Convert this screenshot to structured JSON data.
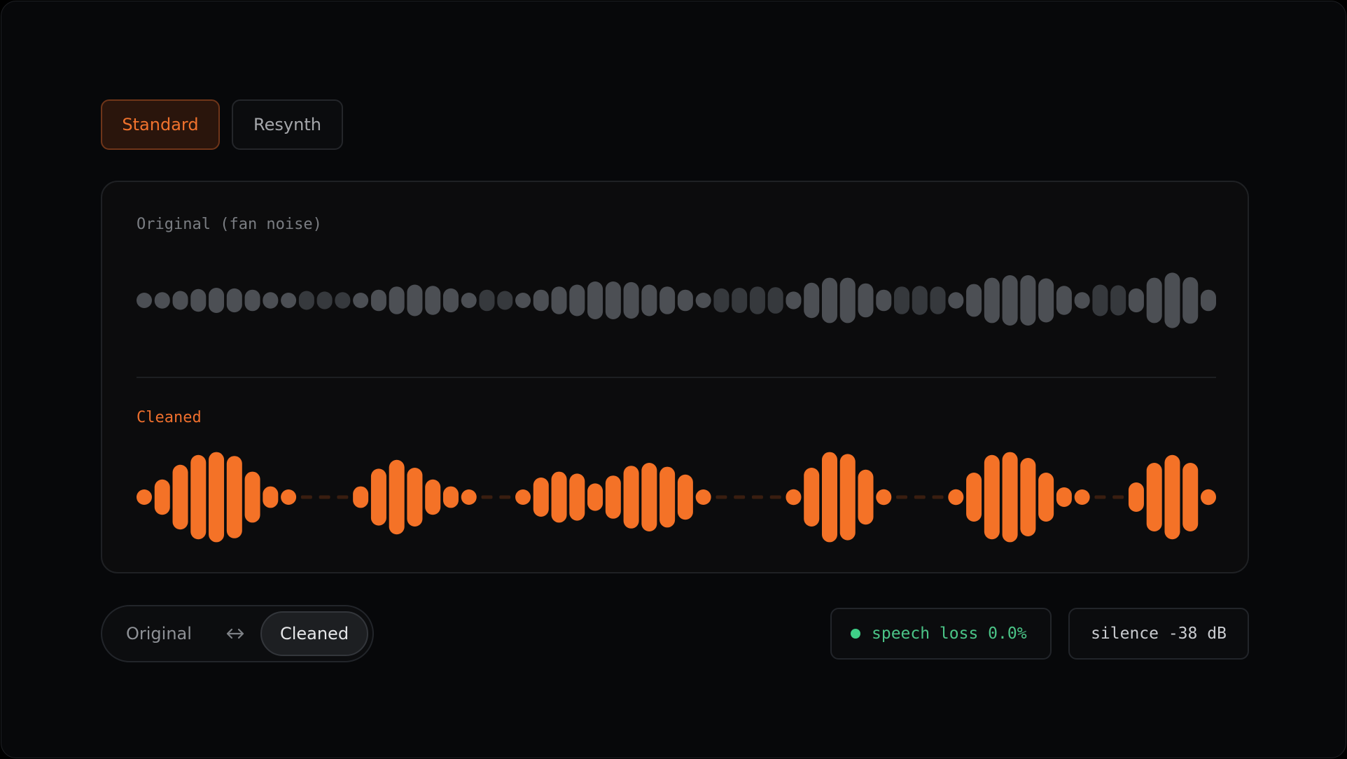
{
  "modes": [
    {
      "label": "Standard",
      "active": true
    },
    {
      "label": "Resynth",
      "active": false
    }
  ],
  "tracks": {
    "original": {
      "label": "Original (fan noise)",
      "color": "#4c4f54",
      "dim_color": "#36393d",
      "levels": [
        0.2,
        0.26,
        0.3,
        0.36,
        0.4,
        0.38,
        0.34,
        0.26,
        0.2,
        0.3,
        0.28,
        0.26,
        0.22,
        0.34,
        0.44,
        0.5,
        0.46,
        0.38,
        0.22,
        0.34,
        0.3,
        0.22,
        0.34,
        0.44,
        0.5,
        0.6,
        0.6,
        0.58,
        0.5,
        0.44,
        0.34,
        0.22,
        0.38,
        0.4,
        0.44,
        0.42,
        0.28,
        0.56,
        0.72,
        0.72,
        0.54,
        0.34,
        0.44,
        0.46,
        0.44,
        0.26,
        0.52,
        0.72,
        0.8,
        0.8,
        0.7,
        0.46,
        0.26,
        0.5,
        0.48,
        0.38,
        0.72,
        0.88,
        0.74,
        0.34
      ],
      "dim": [
        false,
        false,
        false,
        false,
        false,
        false,
        false,
        false,
        false,
        true,
        true,
        true,
        false,
        false,
        false,
        false,
        false,
        false,
        false,
        true,
        true,
        false,
        false,
        false,
        false,
        false,
        false,
        false,
        false,
        false,
        false,
        false,
        true,
        true,
        true,
        true,
        false,
        false,
        false,
        false,
        false,
        false,
        true,
        true,
        true,
        false,
        false,
        false,
        false,
        false,
        false,
        false,
        false,
        true,
        true,
        false,
        false,
        false,
        false,
        false
      ]
    },
    "cleaned": {
      "label": "Cleaned",
      "color": "#f47227",
      "gap_color": "#3a1e10",
      "levels": [
        0.12,
        0.36,
        0.66,
        0.86,
        0.92,
        0.84,
        0.52,
        0.22,
        0.06,
        0,
        0,
        0,
        0.22,
        0.58,
        0.76,
        0.6,
        0.36,
        0.22,
        0.12,
        0,
        0,
        0.12,
        0.4,
        0.52,
        0.48,
        0.28,
        0.44,
        0.64,
        0.7,
        0.62,
        0.46,
        0.12,
        0,
        0,
        0,
        0,
        0.16,
        0.6,
        0.92,
        0.88,
        0.56,
        0.16,
        0,
        0,
        0,
        0.16,
        0.5,
        0.86,
        0.92,
        0.8,
        0.5,
        0.2,
        0.06,
        0,
        0,
        0.3,
        0.7,
        0.86,
        0.7,
        0.16
      ]
    }
  },
  "toggle": {
    "original_label": "Original",
    "cleaned_label": "Cleaned",
    "swap_icon": "swap-horizontal-icon"
  },
  "stats": {
    "speech_loss": "speech loss 0.0%",
    "speech_color": "#3fcf87",
    "silence": "silence -38 dB"
  }
}
